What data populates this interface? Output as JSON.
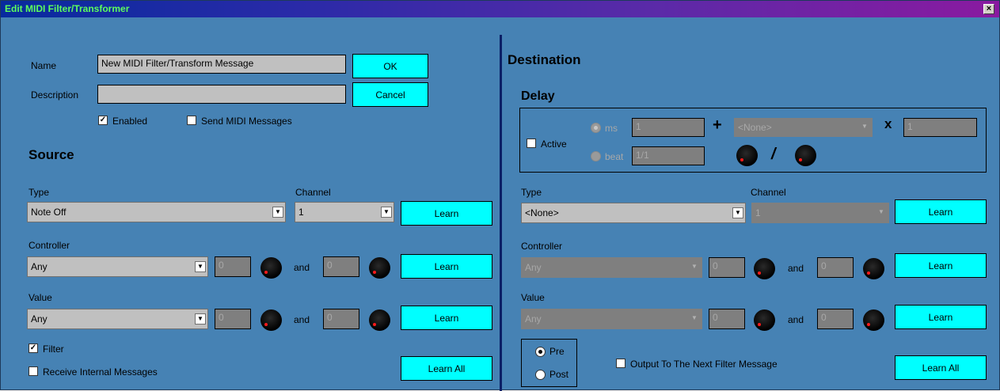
{
  "window": {
    "title": "Edit MIDI Filter/Transformer",
    "close_glyph": "×"
  },
  "header": {
    "name_label": "Name",
    "name_value": "New MIDI Filter/Transform Message",
    "description_label": "Description",
    "description_value": "",
    "ok_label": "OK",
    "cancel_label": "Cancel",
    "enabled_label": "Enabled",
    "enabled_checked": true,
    "send_midi_label": "Send MIDI Messages",
    "send_midi_checked": false
  },
  "source": {
    "heading": "Source",
    "type_label": "Type",
    "type_value": "Note Off",
    "channel_label": "Channel",
    "channel_value": "1",
    "learn_label": "Learn",
    "controller_label": "Controller",
    "controller_value": "Any",
    "controller_min": "0",
    "controller_max": "0",
    "and_label": "and",
    "value_label": "Value",
    "value_value": "Any",
    "value_min": "0",
    "value_max": "0",
    "filter_label": "Filter",
    "filter_checked": true,
    "receive_internal_label": "Receive Internal Messages",
    "receive_internal_checked": false,
    "learn_all_label": "Learn All"
  },
  "destination": {
    "heading": "Destination",
    "delay": {
      "heading": "Delay",
      "active_label": "Active",
      "active_checked": false,
      "ms_label": "ms",
      "ms_value": "1",
      "beat_label": "beat",
      "beat_value": "1/1",
      "plus_symbol": "+",
      "times_symbol": "x",
      "divide_symbol": "/",
      "source_value": "<None>",
      "multiplier_value": "1"
    },
    "type_label": "Type",
    "type_value": "<None>",
    "channel_label": "Channel",
    "channel_value": "1",
    "learn_label": "Learn",
    "controller_label": "Controller",
    "controller_value": "Any",
    "controller_min": "0",
    "controller_max": "0",
    "and_label": "and",
    "value_label": "Value",
    "value_value": "Any",
    "value_min": "0",
    "value_max": "0",
    "pre_label": "Pre",
    "post_label": "Post",
    "pre_selected": true,
    "output_next_label": "Output To The Next Filter Message",
    "output_next_checked": false,
    "learn_all_label": "Learn All"
  },
  "colors": {
    "background": "#4682b4",
    "button": "#00ffff",
    "title_text": "#5dff5d",
    "divider": "#0b1f66"
  }
}
